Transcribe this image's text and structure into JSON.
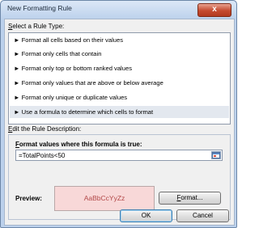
{
  "window": {
    "title": "New Formatting Rule",
    "close_label": "x"
  },
  "rule_type": {
    "heading": "elect a Rule Type:",
    "heading_underlined": "S",
    "items": [
      {
        "marker": "►",
        "label": "Format all cells based on their values"
      },
      {
        "marker": "►",
        "label": "Format only cells that contain"
      },
      {
        "marker": "►",
        "label": "Format only top or bottom ranked values"
      },
      {
        "marker": "►",
        "label": "Format only values that are above or below average"
      },
      {
        "marker": "►",
        "label": "Format only unique or duplicate values"
      },
      {
        "marker": "►",
        "label": "Use a formula to determine which cells to format"
      }
    ],
    "selected_index": 5
  },
  "rule_description": {
    "heading": "dit the Rule Description:",
    "heading_underlined": "E",
    "formula_label": "ormat values where this formula is true:",
    "formula_label_underlined": "F",
    "formula_value": "=TotalPoints<50",
    "preview_label": "Preview:",
    "preview_text": "AaBbCcYyZz",
    "format_button": "ormat...",
    "format_button_underlined": "F"
  },
  "buttons": {
    "ok": "OK",
    "cancel": "Cancel"
  },
  "colors": {
    "preview_fill": "#f8d8d8",
    "preview_text": "#b24848",
    "selected_row": "#e3e8ef"
  }
}
